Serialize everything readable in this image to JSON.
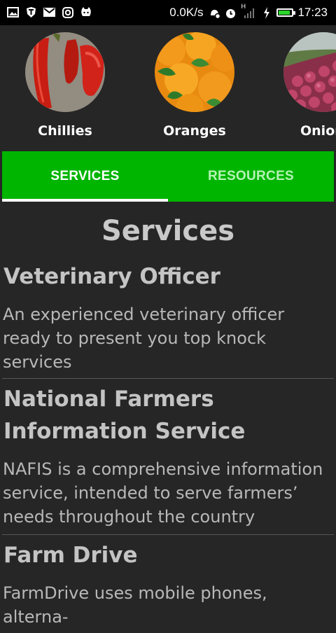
{
  "status_bar": {
    "speed": "0.0K/s",
    "network": "H",
    "time": "17:23",
    "battery_level": 0.9
  },
  "crops": [
    {
      "label": "Chillies",
      "icon": "chillies-image"
    },
    {
      "label": "Oranges",
      "icon": "oranges-image"
    },
    {
      "label": "Onion",
      "icon": "onions-image"
    }
  ],
  "tabs": [
    {
      "label": "SERVICES",
      "active": true
    },
    {
      "label": "RESOURCES",
      "active": false
    }
  ],
  "page": {
    "title": "Services"
  },
  "services": [
    {
      "title": "Veterinary Officer",
      "description": "An experienced veterinary officer ready to present you top knock services"
    },
    {
      "title": "National Farmers Information Service",
      "description": "NAFIS is a comprehensive information service, intended to serve farmers’ needs throughout the country including"
    },
    {
      "title": "Farm Drive",
      "description": "FarmDrive uses mobile phones, alterna-"
    }
  ],
  "colors": {
    "tab_bar": "#00b500",
    "background": "#262626"
  }
}
